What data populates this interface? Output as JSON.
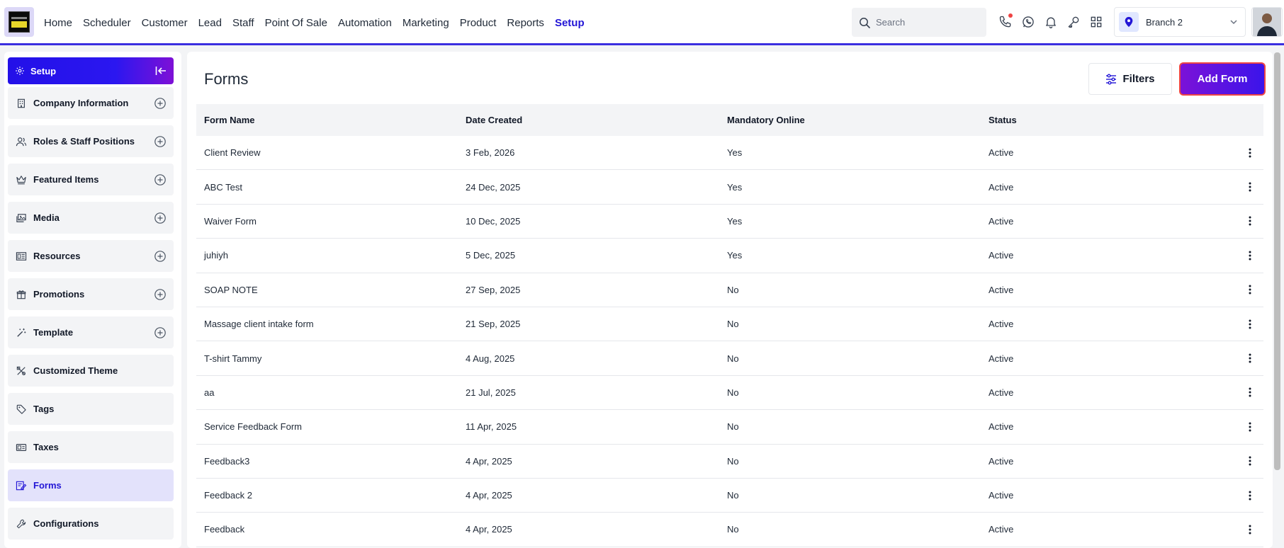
{
  "nav": {
    "items": [
      "Home",
      "Scheduler",
      "Customer",
      "Lead",
      "Staff",
      "Point Of Sale",
      "Automation",
      "Marketing",
      "Product",
      "Reports",
      "Setup"
    ],
    "active": "Setup",
    "search_placeholder": "Search",
    "branch": "Branch 2",
    "icons": [
      "phone-icon",
      "whatsapp-icon",
      "bell-icon",
      "key-icon",
      "apps-grid-icon"
    ]
  },
  "sidebar": {
    "header": "Setup",
    "items": [
      {
        "label": "Company Information",
        "icon": "building-icon",
        "expandable": true
      },
      {
        "label": "Roles & Staff Positions",
        "icon": "users-icon",
        "expandable": true
      },
      {
        "label": "Featured Items",
        "icon": "crown-icon",
        "expandable": true
      },
      {
        "label": "Media",
        "icon": "media-icon",
        "expandable": true
      },
      {
        "label": "Resources",
        "icon": "resources-icon",
        "expandable": true
      },
      {
        "label": "Promotions",
        "icon": "gift-icon",
        "expandable": true
      },
      {
        "label": "Template",
        "icon": "magic-wand-icon",
        "expandable": true
      },
      {
        "label": "Customized Theme",
        "icon": "theme-icon",
        "expandable": false
      },
      {
        "label": "Tags",
        "icon": "tag-icon",
        "expandable": false
      },
      {
        "label": "Taxes",
        "icon": "taxes-icon",
        "expandable": false
      },
      {
        "label": "Forms",
        "icon": "form-icon",
        "expandable": false,
        "active": true
      },
      {
        "label": "Configurations",
        "icon": "wrench-icon",
        "expandable": false
      }
    ]
  },
  "main": {
    "title": "Forms",
    "filters_label": "Filters",
    "add_label": "Add Form",
    "columns": [
      "Form Name",
      "Date Created",
      "Mandatory Online",
      "Status"
    ],
    "rows": [
      [
        "Client Review",
        "3 Feb, 2026",
        "Yes",
        "Active"
      ],
      [
        "ABC Test",
        "24 Dec, 2025",
        "Yes",
        "Active"
      ],
      [
        "Waiver Form",
        "10 Dec, 2025",
        "Yes",
        "Active"
      ],
      [
        "juhiyh",
        "5 Dec, 2025",
        "Yes",
        "Active"
      ],
      [
        "SOAP NOTE",
        "27 Sep, 2025",
        "No",
        "Active"
      ],
      [
        "Massage client intake form",
        "21 Sep, 2025",
        "No",
        "Active"
      ],
      [
        "T-shirt Tammy",
        "4 Aug, 2025",
        "No",
        "Active"
      ],
      [
        "aa",
        "21 Jul, 2025",
        "No",
        "Active"
      ],
      [
        "Service Feedback Form",
        "11 Apr, 2025",
        "No",
        "Active"
      ],
      [
        "Feedback3",
        "4 Apr, 2025",
        "No",
        "Active"
      ],
      [
        "Feedback 2",
        "4 Apr, 2025",
        "No",
        "Active"
      ],
      [
        "Feedback",
        "4 Apr, 2025",
        "No",
        "Active"
      ]
    ]
  },
  "colors": {
    "accent": "#2316d6",
    "brand_gradient_end": "#7b12d8",
    "active_bg": "#e3e2fb"
  }
}
